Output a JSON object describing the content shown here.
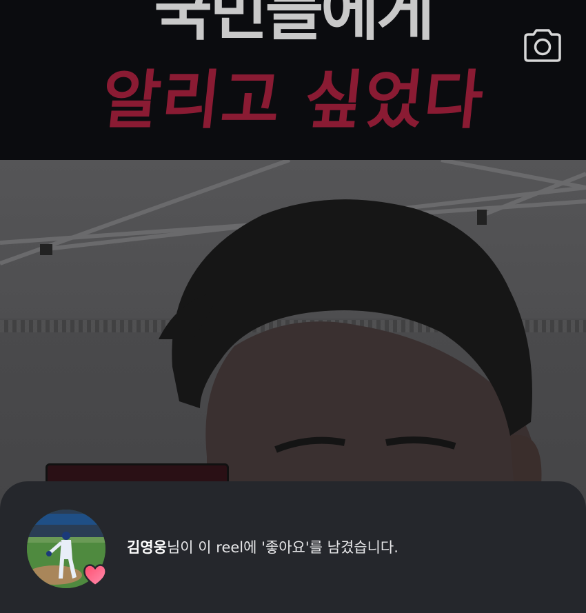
{
  "reel": {
    "caption_line1": "국민들에게",
    "caption_line2": "알리고 싶었다",
    "camera_icon": "camera-icon"
  },
  "notification": {
    "username": "김영웅",
    "message": "님이 이 reel에 '좋아요'를 남겼습니다.",
    "avatar_icon": "avatar",
    "badge_icon": "heart-icon"
  },
  "colors": {
    "caption_line1": "#c9c9c9",
    "caption_line2": "#8a1b33",
    "sheet_background": "#25272c",
    "heart_gradient_start": "#ff4d6d",
    "heart_gradient_end": "#ff8fb1"
  }
}
